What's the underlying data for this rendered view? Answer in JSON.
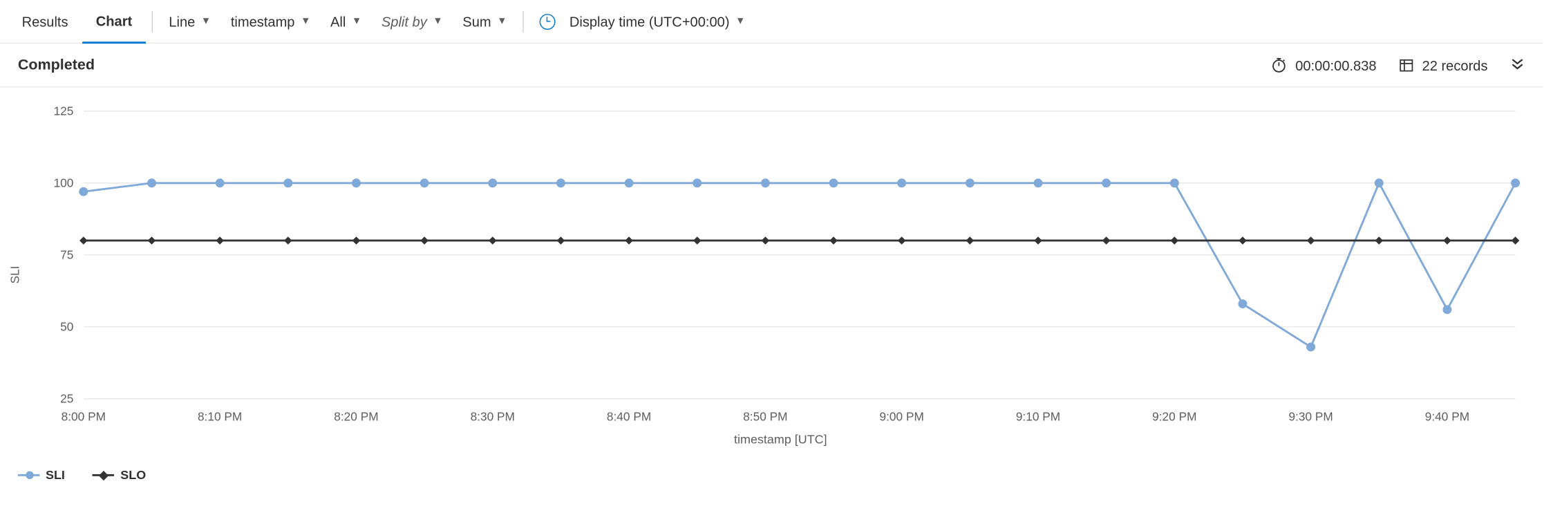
{
  "toolbar": {
    "tabs": {
      "results": "Results",
      "chart": "Chart"
    },
    "chart_type": "Line",
    "x_field": "timestamp",
    "y_field": "All",
    "split_by": "Split by",
    "aggregation": "Sum",
    "display_time": "Display time (UTC+00:00)"
  },
  "status": {
    "title": "Completed",
    "duration": "00:00:00.838",
    "records": "22 records"
  },
  "chart_data": {
    "type": "line",
    "xlabel": "timestamp [UTC]",
    "ylabel": "SLI",
    "ylim": [
      25,
      125
    ],
    "yticks": [
      25,
      50,
      75,
      100,
      125
    ],
    "xticks": [
      "8:00 PM",
      "8:10 PM",
      "8:20 PM",
      "8:30 PM",
      "8:40 PM",
      "8:50 PM",
      "9:00 PM",
      "9:10 PM",
      "9:20 PM",
      "9:30 PM",
      "9:40 PM"
    ],
    "categories": [
      "8:00 PM",
      "8:05 PM",
      "8:10 PM",
      "8:15 PM",
      "8:20 PM",
      "8:25 PM",
      "8:30 PM",
      "8:35 PM",
      "8:40 PM",
      "8:45 PM",
      "8:50 PM",
      "8:55 PM",
      "9:00 PM",
      "9:05 PM",
      "9:10 PM",
      "9:15 PM",
      "9:20 PM",
      "9:25 PM",
      "9:30 PM",
      "9:35 PM",
      "9:40 PM",
      "9:45 PM"
    ],
    "series": [
      {
        "name": "SLI",
        "values": [
          97,
          100,
          100,
          100,
          100,
          100,
          100,
          100,
          100,
          100,
          100,
          100,
          100,
          100,
          100,
          100,
          100,
          58,
          43,
          100,
          56,
          100
        ]
      },
      {
        "name": "SLO",
        "values": [
          80,
          80,
          80,
          80,
          80,
          80,
          80,
          80,
          80,
          80,
          80,
          80,
          80,
          80,
          80,
          80,
          80,
          80,
          80,
          80,
          80,
          80
        ]
      }
    ]
  },
  "legend": {
    "sli": "SLI",
    "slo": "SLO"
  }
}
